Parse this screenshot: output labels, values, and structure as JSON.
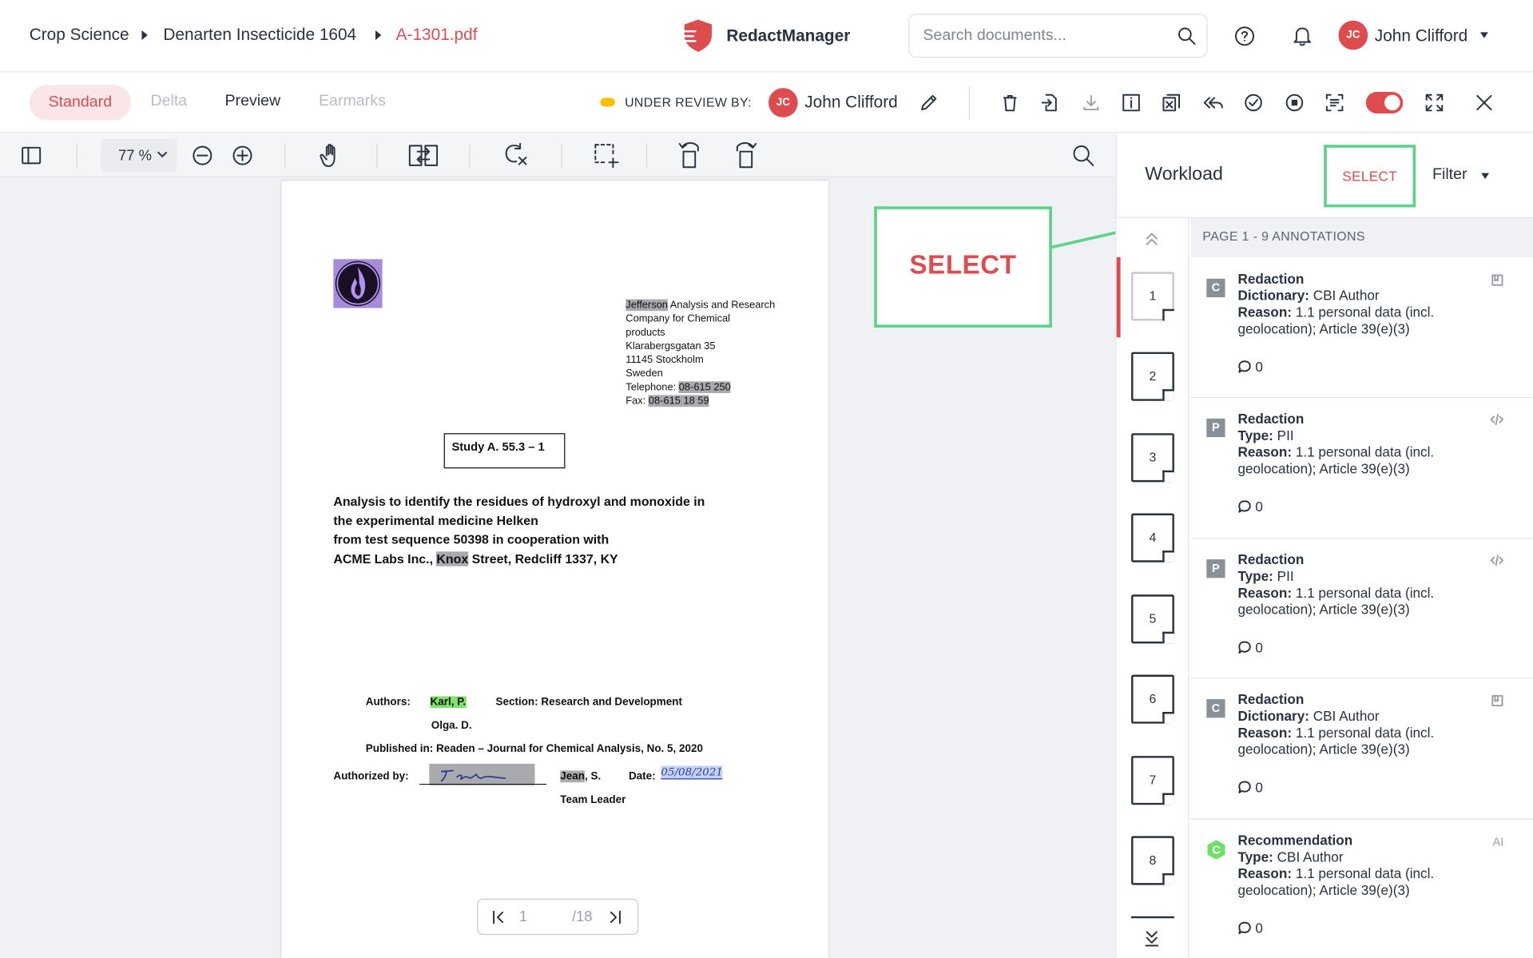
{
  "header": {
    "breadcrumb": [
      "Crop Science",
      "Denarten Insecticide 1604",
      "A-1301.pdf"
    ],
    "app_name": "RedactManager",
    "search_placeholder": "Search documents...",
    "user": {
      "initials": "JC",
      "name": "John Clifford"
    }
  },
  "action_bar": {
    "tabs": [
      "Standard",
      "Delta",
      "Preview",
      "Earmarks"
    ],
    "status_label": "UNDER REVIEW BY:",
    "reviewer": {
      "initials": "JC",
      "name": "John Clifford"
    },
    "accent_color": "#dd4d50"
  },
  "viewer_toolbar": {
    "zoom": "77 %"
  },
  "document": {
    "address": [
      {
        "pre": "",
        "hl": "Jefferson",
        "post": " Analysis and Research"
      },
      {
        "pre": "Company for Chemical",
        "hl": "",
        "post": ""
      },
      {
        "pre": "products",
        "hl": "",
        "post": ""
      },
      {
        "pre": "Klarabergsgatan 35",
        "hl": "",
        "post": ""
      },
      {
        "pre": "11145 Stockholm",
        "hl": "",
        "post": ""
      },
      {
        "pre": "Sweden",
        "hl": "",
        "post": ""
      },
      {
        "pre": "Telephone: ",
        "hl": "08-615 250",
        "post": ""
      },
      {
        "pre": "Fax: ",
        "hl": "08-615 18 59",
        "post": ""
      }
    ],
    "study_box": "Study A. 55.3 – 1",
    "title_lines": [
      "Analysis to identify the residues of hydroxyl and monoxide in",
      "the experimental medicine Helken",
      "from test sequence 50398 in cooperation with"
    ],
    "title_last": {
      "pre": "ACME Labs Inc., ",
      "hl": "Knox",
      "post": " Street, Redcliff 1337, KY"
    },
    "authors_label": "Authors:",
    "author1": "Karl, P.",
    "section": "Section: Research and Development",
    "author2": "Olga. D.",
    "published": "Published in: Readen – Journal for Chemical Analysis, No. 5, 2020",
    "authorized_label": "Authorized by:",
    "authorized_name_hl": "Jean",
    "authorized_name_post": ", S.",
    "date_label": "Date:",
    "date_value": "05/08/2021",
    "role": "Team Leader",
    "page_current": "1",
    "page_total": "/18"
  },
  "callout": {
    "text": "SELECT"
  },
  "workload": {
    "title": "Workload",
    "select_label": "SELECT",
    "filter_label": "Filter",
    "page_header": "PAGE 1 - 9 ANNOTATIONS",
    "thumbnails": [
      "1",
      "2",
      "3",
      "4",
      "5",
      "6",
      "7",
      "8"
    ],
    "annotations": [
      {
        "badge": "C",
        "title": "Redaction",
        "field": "Dictionary:",
        "value": "CBI Author",
        "reason_label": "Reason:",
        "reason": "1.1 personal data (incl. geolocation); Article 39(e)(3)",
        "comments": "0",
        "icon": "dictionary-icon"
      },
      {
        "badge": "P",
        "title": "Redaction",
        "field": "Type:",
        "value": "PII",
        "reason_label": "Reason:",
        "reason": "1.1 personal data (incl. geolocation); Article 39(e)(3)",
        "comments": "0",
        "icon": "code-icon"
      },
      {
        "badge": "P",
        "title": "Redaction",
        "field": "Type:",
        "value": "PII",
        "reason_label": "Reason:",
        "reason": "1.1 personal data (incl. geolocation); Article 39(e)(3)",
        "comments": "0",
        "icon": "code-icon"
      },
      {
        "badge": "C",
        "title": "Redaction",
        "field": "Dictionary:",
        "value": "CBI Author",
        "reason_label": "Reason:",
        "reason": "1.1 personal data (incl. geolocation); Article 39(e)(3)",
        "comments": "0",
        "icon": "dictionary-icon"
      },
      {
        "badge": "C",
        "title": "Recommendation",
        "field": "Type:",
        "value": "CBI Author",
        "reason_label": "Reason:",
        "reason": "1.1 personal data (incl. geolocation); Article 39(e)(3)",
        "comments": "0",
        "icon": "ai-icon",
        "icon_text": "AI"
      }
    ]
  }
}
